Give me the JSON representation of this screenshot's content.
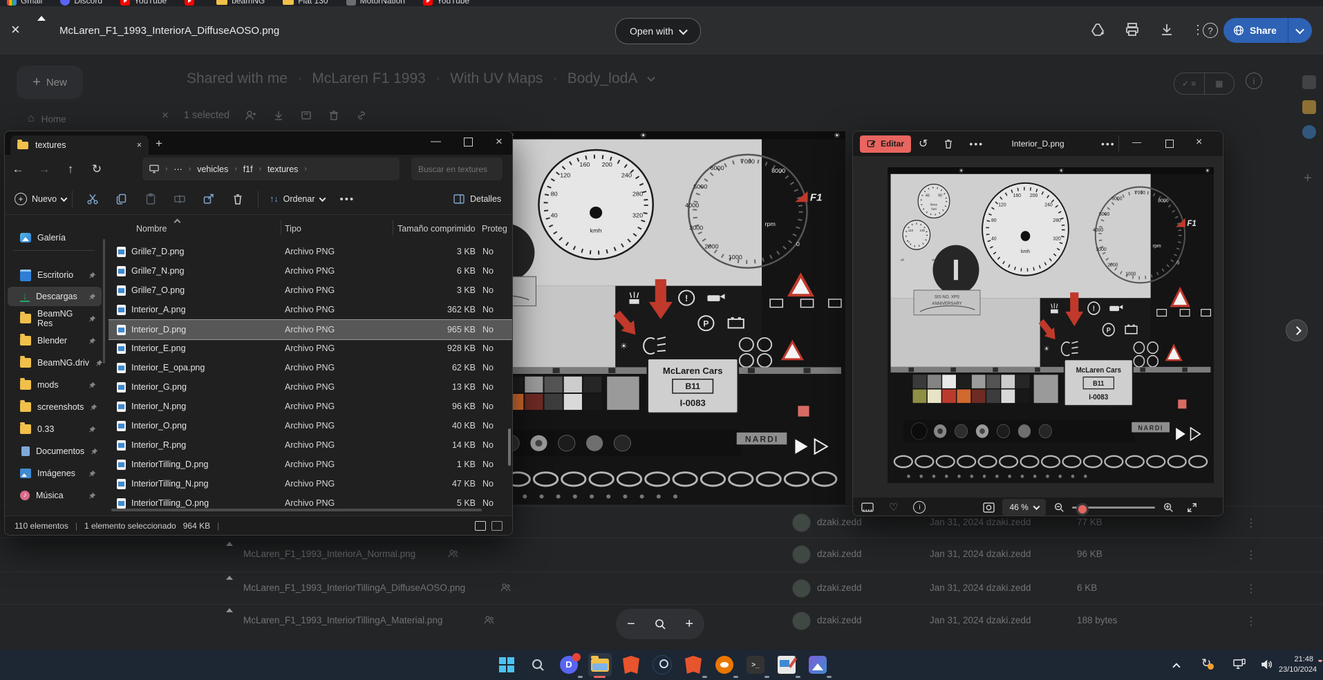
{
  "bookmarks_bar": {
    "items": [
      {
        "label": "Gmail"
      },
      {
        "label": "Discord"
      },
      {
        "label": "YouTube"
      },
      {
        "label": ""
      },
      {
        "label": "beamNG"
      },
      {
        "label": "Fiat 130"
      },
      {
        "label": "MotorNation"
      },
      {
        "label": "YouTube"
      }
    ]
  },
  "drive_preview": {
    "filename": "McLaren_F1_1993_InteriorA_DiffuseAOSO.png",
    "open_with_label": "Open with",
    "share_label": "Share"
  },
  "drive_page": {
    "new_button": "New",
    "home_item": "Home",
    "selected_count": "1 selected",
    "breadcrumb": [
      "Shared with me",
      "McLaren F1 1993",
      "With UV Maps",
      "Body_lodA"
    ],
    "rows": [
      {
        "owner": "dzaki.zedd",
        "modified": "Jan 31, 2024 dzaki.zedd",
        "size": "77 KB"
      },
      {
        "name": "McLaren_F1_1993_InteriorA_Normal.png",
        "owner": "dzaki.zedd",
        "modified": "Jan 31, 2024 dzaki.zedd",
        "size": "96 KB"
      },
      {
        "name": "McLaren_F1_1993_InteriorTillingA_DiffuseAOSO.png",
        "owner": "dzaki.zedd",
        "modified": "Jan 31, 2024 dzaki.zedd",
        "size": "6 KB"
      },
      {
        "name": "McLaren_F1_1993_InteriorTillingA_Material.png",
        "owner": "dzaki.zedd",
        "modified": "Jan 31, 2024 dzaki.zedd",
        "size": "188 bytes"
      }
    ]
  },
  "explorer": {
    "tab": "textures",
    "address": [
      "vehicles",
      "f1f",
      "textures"
    ],
    "search_placeholder": "Buscar en textures",
    "toolbar": {
      "new": "Nuevo",
      "sort": "Ordenar",
      "details": "Detalles"
    },
    "columns": {
      "name": "Nombre",
      "type": "Tipo",
      "size": "Tamaño comprimido",
      "protected": "Proteg"
    },
    "sidebar": [
      {
        "label": "Galería"
      },
      {
        "label": "Escritorio"
      },
      {
        "label": "Descargas"
      },
      {
        "label": "BeamNG Res"
      },
      {
        "label": "Blender"
      },
      {
        "label": "BeamNG.driv"
      },
      {
        "label": "mods"
      },
      {
        "label": "screenshots"
      },
      {
        "label": "0.33"
      },
      {
        "label": "Documentos"
      },
      {
        "label": "Imágenes"
      },
      {
        "label": "Música"
      }
    ],
    "files": [
      {
        "name": "Grille7_D.png",
        "type": "Archivo PNG",
        "size": "3 KB",
        "prot": "No"
      },
      {
        "name": "Grille7_N.png",
        "type": "Archivo PNG",
        "size": "6 KB",
        "prot": "No"
      },
      {
        "name": "Grille7_O.png",
        "type": "Archivo PNG",
        "size": "3 KB",
        "prot": "No"
      },
      {
        "name": "Interior_A.png",
        "type": "Archivo PNG",
        "size": "362 KB",
        "prot": "No"
      },
      {
        "name": "Interior_D.png",
        "type": "Archivo PNG",
        "size": "965 KB",
        "prot": "No"
      },
      {
        "name": "Interior_E.png",
        "type": "Archivo PNG",
        "size": "928 KB",
        "prot": "No"
      },
      {
        "name": "Interior_E_opa.png",
        "type": "Archivo PNG",
        "size": "62 KB",
        "prot": "No"
      },
      {
        "name": "Interior_G.png",
        "type": "Archivo PNG",
        "size": "13 KB",
        "prot": "No"
      },
      {
        "name": "Interior_N.png",
        "type": "Archivo PNG",
        "size": "96 KB",
        "prot": "No"
      },
      {
        "name": "Interior_O.png",
        "type": "Archivo PNG",
        "size": "40 KB",
        "prot": "No"
      },
      {
        "name": "Interior_R.png",
        "type": "Archivo PNG",
        "size": "14 KB",
        "prot": "No"
      },
      {
        "name": "InteriorTilling_D.png",
        "type": "Archivo PNG",
        "size": "1 KB",
        "prot": "No"
      },
      {
        "name": "InteriorTilling_N.png",
        "type": "Archivo PNG",
        "size": "47 KB",
        "prot": "No"
      },
      {
        "name": "InteriorTilling_O.png",
        "type": "Archivo PNG",
        "size": "5 KB",
        "prot": "No"
      }
    ],
    "status": {
      "count": "110 elementos",
      "sep": "|",
      "selected": "1 elemento seleccionado",
      "size": "964 KB",
      "sep2": "|"
    }
  },
  "photos": {
    "edit_label": "Editar",
    "title": "Interior_D.png",
    "zoom_value": "46 %"
  },
  "texture": {
    "kmh": "kmh",
    "rpm": "rpm",
    "f1": "F1",
    "speed": [
      "40",
      "80",
      "120",
      "160",
      "200",
      "240",
      "280",
      "320"
    ],
    "tach": [
      "1000",
      "2000",
      "3000",
      "4000",
      "5000",
      "6000",
      "7000",
      "8000"
    ],
    "zero": "0",
    "small_dial": [
      "45",
      "90",
      "110",
      "130"
    ],
    "litres": "litres",
    "fuel": "fuel",
    "oil": "oil",
    "water": "water",
    "celsius": "°c",
    "plate_line1": "SIS NO. XPS",
    "plate_line2": "ANNIVERSARY",
    "mclaren": "McLaren Cars",
    "code": "B11",
    "serial": "I-0083",
    "nardi": "NARDI"
  },
  "taskbar": {
    "time": "21:48",
    "date": "23/10/2024"
  },
  "colors": {
    "accent_blue": "#2d62b5",
    "edit_red": "#e9655f",
    "selection_gray": "#575757"
  }
}
